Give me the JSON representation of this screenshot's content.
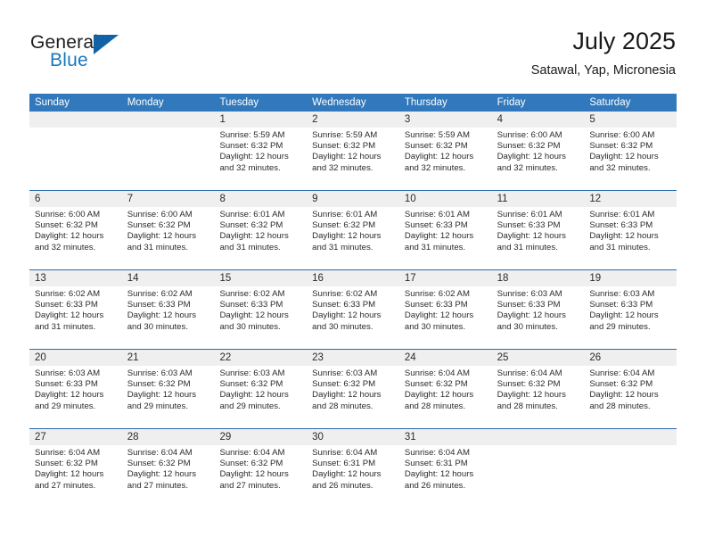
{
  "logo": {
    "word1": "General",
    "word2": "Blue",
    "triangle_color": "#1162a6",
    "blue_text_color": "#1878be"
  },
  "header": {
    "month_title": "July 2025",
    "location": "Satawal, Yap, Micronesia"
  },
  "theme": {
    "header_bar_color": "#3179bc",
    "week_divider_color": "#2c6ca8",
    "date_band_color": "#efefef"
  },
  "weekday_headers": [
    "Sunday",
    "Monday",
    "Tuesday",
    "Wednesday",
    "Thursday",
    "Friday",
    "Saturday"
  ],
  "weeks": [
    [
      {
        "day": "",
        "sunrise": "",
        "sunset": "",
        "daylight_line1": "",
        "daylight_line2": "",
        "empty": true
      },
      {
        "day": "",
        "sunrise": "",
        "sunset": "",
        "daylight_line1": "",
        "daylight_line2": "",
        "empty": true
      },
      {
        "day": "1",
        "sunrise": "Sunrise: 5:59 AM",
        "sunset": "Sunset: 6:32 PM",
        "daylight_line1": "Daylight: 12 hours",
        "daylight_line2": "and 32 minutes."
      },
      {
        "day": "2",
        "sunrise": "Sunrise: 5:59 AM",
        "sunset": "Sunset: 6:32 PM",
        "daylight_line1": "Daylight: 12 hours",
        "daylight_line2": "and 32 minutes."
      },
      {
        "day": "3",
        "sunrise": "Sunrise: 5:59 AM",
        "sunset": "Sunset: 6:32 PM",
        "daylight_line1": "Daylight: 12 hours",
        "daylight_line2": "and 32 minutes."
      },
      {
        "day": "4",
        "sunrise": "Sunrise: 6:00 AM",
        "sunset": "Sunset: 6:32 PM",
        "daylight_line1": "Daylight: 12 hours",
        "daylight_line2": "and 32 minutes."
      },
      {
        "day": "5",
        "sunrise": "Sunrise: 6:00 AM",
        "sunset": "Sunset: 6:32 PM",
        "daylight_line1": "Daylight: 12 hours",
        "daylight_line2": "and 32 minutes."
      }
    ],
    [
      {
        "day": "6",
        "sunrise": "Sunrise: 6:00 AM",
        "sunset": "Sunset: 6:32 PM",
        "daylight_line1": "Daylight: 12 hours",
        "daylight_line2": "and 32 minutes."
      },
      {
        "day": "7",
        "sunrise": "Sunrise: 6:00 AM",
        "sunset": "Sunset: 6:32 PM",
        "daylight_line1": "Daylight: 12 hours",
        "daylight_line2": "and 31 minutes."
      },
      {
        "day": "8",
        "sunrise": "Sunrise: 6:01 AM",
        "sunset": "Sunset: 6:32 PM",
        "daylight_line1": "Daylight: 12 hours",
        "daylight_line2": "and 31 minutes."
      },
      {
        "day": "9",
        "sunrise": "Sunrise: 6:01 AM",
        "sunset": "Sunset: 6:32 PM",
        "daylight_line1": "Daylight: 12 hours",
        "daylight_line2": "and 31 minutes."
      },
      {
        "day": "10",
        "sunrise": "Sunrise: 6:01 AM",
        "sunset": "Sunset: 6:33 PM",
        "daylight_line1": "Daylight: 12 hours",
        "daylight_line2": "and 31 minutes."
      },
      {
        "day": "11",
        "sunrise": "Sunrise: 6:01 AM",
        "sunset": "Sunset: 6:33 PM",
        "daylight_line1": "Daylight: 12 hours",
        "daylight_line2": "and 31 minutes."
      },
      {
        "day": "12",
        "sunrise": "Sunrise: 6:01 AM",
        "sunset": "Sunset: 6:33 PM",
        "daylight_line1": "Daylight: 12 hours",
        "daylight_line2": "and 31 minutes."
      }
    ],
    [
      {
        "day": "13",
        "sunrise": "Sunrise: 6:02 AM",
        "sunset": "Sunset: 6:33 PM",
        "daylight_line1": "Daylight: 12 hours",
        "daylight_line2": "and 31 minutes."
      },
      {
        "day": "14",
        "sunrise": "Sunrise: 6:02 AM",
        "sunset": "Sunset: 6:33 PM",
        "daylight_line1": "Daylight: 12 hours",
        "daylight_line2": "and 30 minutes."
      },
      {
        "day": "15",
        "sunrise": "Sunrise: 6:02 AM",
        "sunset": "Sunset: 6:33 PM",
        "daylight_line1": "Daylight: 12 hours",
        "daylight_line2": "and 30 minutes."
      },
      {
        "day": "16",
        "sunrise": "Sunrise: 6:02 AM",
        "sunset": "Sunset: 6:33 PM",
        "daylight_line1": "Daylight: 12 hours",
        "daylight_line2": "and 30 minutes."
      },
      {
        "day": "17",
        "sunrise": "Sunrise: 6:02 AM",
        "sunset": "Sunset: 6:33 PM",
        "daylight_line1": "Daylight: 12 hours",
        "daylight_line2": "and 30 minutes."
      },
      {
        "day": "18",
        "sunrise": "Sunrise: 6:03 AM",
        "sunset": "Sunset: 6:33 PM",
        "daylight_line1": "Daylight: 12 hours",
        "daylight_line2": "and 30 minutes."
      },
      {
        "day": "19",
        "sunrise": "Sunrise: 6:03 AM",
        "sunset": "Sunset: 6:33 PM",
        "daylight_line1": "Daylight: 12 hours",
        "daylight_line2": "and 29 minutes."
      }
    ],
    [
      {
        "day": "20",
        "sunrise": "Sunrise: 6:03 AM",
        "sunset": "Sunset: 6:33 PM",
        "daylight_line1": "Daylight: 12 hours",
        "daylight_line2": "and 29 minutes."
      },
      {
        "day": "21",
        "sunrise": "Sunrise: 6:03 AM",
        "sunset": "Sunset: 6:32 PM",
        "daylight_line1": "Daylight: 12 hours",
        "daylight_line2": "and 29 minutes."
      },
      {
        "day": "22",
        "sunrise": "Sunrise: 6:03 AM",
        "sunset": "Sunset: 6:32 PM",
        "daylight_line1": "Daylight: 12 hours",
        "daylight_line2": "and 29 minutes."
      },
      {
        "day": "23",
        "sunrise": "Sunrise: 6:03 AM",
        "sunset": "Sunset: 6:32 PM",
        "daylight_line1": "Daylight: 12 hours",
        "daylight_line2": "and 28 minutes."
      },
      {
        "day": "24",
        "sunrise": "Sunrise: 6:04 AM",
        "sunset": "Sunset: 6:32 PM",
        "daylight_line1": "Daylight: 12 hours",
        "daylight_line2": "and 28 minutes."
      },
      {
        "day": "25",
        "sunrise": "Sunrise: 6:04 AM",
        "sunset": "Sunset: 6:32 PM",
        "daylight_line1": "Daylight: 12 hours",
        "daylight_line2": "and 28 minutes."
      },
      {
        "day": "26",
        "sunrise": "Sunrise: 6:04 AM",
        "sunset": "Sunset: 6:32 PM",
        "daylight_line1": "Daylight: 12 hours",
        "daylight_line2": "and 28 minutes."
      }
    ],
    [
      {
        "day": "27",
        "sunrise": "Sunrise: 6:04 AM",
        "sunset": "Sunset: 6:32 PM",
        "daylight_line1": "Daylight: 12 hours",
        "daylight_line2": "and 27 minutes."
      },
      {
        "day": "28",
        "sunrise": "Sunrise: 6:04 AM",
        "sunset": "Sunset: 6:32 PM",
        "daylight_line1": "Daylight: 12 hours",
        "daylight_line2": "and 27 minutes."
      },
      {
        "day": "29",
        "sunrise": "Sunrise: 6:04 AM",
        "sunset": "Sunset: 6:32 PM",
        "daylight_line1": "Daylight: 12 hours",
        "daylight_line2": "and 27 minutes."
      },
      {
        "day": "30",
        "sunrise": "Sunrise: 6:04 AM",
        "sunset": "Sunset: 6:31 PM",
        "daylight_line1": "Daylight: 12 hours",
        "daylight_line2": "and 26 minutes."
      },
      {
        "day": "31",
        "sunrise": "Sunrise: 6:04 AM",
        "sunset": "Sunset: 6:31 PM",
        "daylight_line1": "Daylight: 12 hours",
        "daylight_line2": "and 26 minutes."
      },
      {
        "day": "",
        "sunrise": "",
        "sunset": "",
        "daylight_line1": "",
        "daylight_line2": "",
        "empty": true
      },
      {
        "day": "",
        "sunrise": "",
        "sunset": "",
        "daylight_line1": "",
        "daylight_line2": "",
        "empty": true
      }
    ]
  ]
}
